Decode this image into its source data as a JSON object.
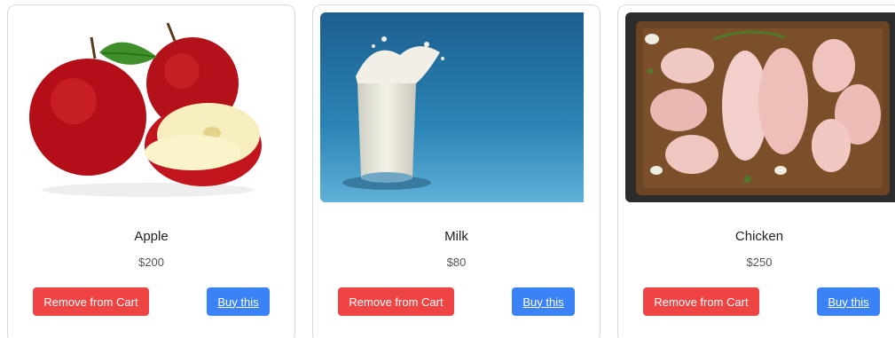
{
  "products": [
    {
      "name": "Apple",
      "price": "$200",
      "remove_label": "Remove from Cart",
      "buy_label": "Buy this"
    },
    {
      "name": "Milk",
      "price": "$80",
      "remove_label": "Remove from Cart",
      "buy_label": "Buy this"
    },
    {
      "name": "Chicken",
      "price": "$250",
      "remove_label": "Remove from Cart",
      "buy_label": "Buy this"
    }
  ],
  "colors": {
    "remove_button": "#ef4444",
    "buy_button": "#3b82f6",
    "card_border": "#d9d9d9"
  }
}
